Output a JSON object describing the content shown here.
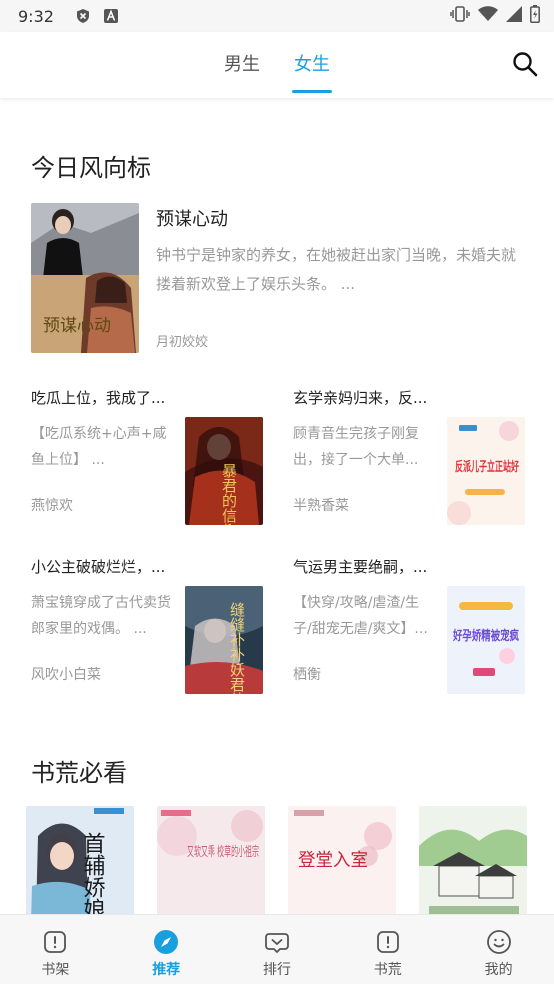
{
  "status": {
    "time": "9:32"
  },
  "tabs": [
    {
      "label": "男生",
      "active": false
    },
    {
      "label": "女生",
      "active": true
    }
  ],
  "accent_color": "#1a9fde",
  "today": {
    "title": "今日风向标",
    "featured": {
      "title": "预谋心动",
      "desc": "钟书宁是钟家的养女，在她被赶出家门当晚，未婚夫就搂着新欢登上了娱乐头条。 ...",
      "author": "月初姣姣",
      "cover_text": "预谋心动"
    },
    "books": [
      {
        "title": "吃瓜上位，我成了...",
        "desc": "【吃瓜系统+心声+咸鱼上位】 ...",
        "author": "燕惊欢",
        "cover_text": "暴君的信仰"
      },
      {
        "title": "玄学亲妈归来，反...",
        "desc": "顾青音生完孩子刚复出，接了一个大单...",
        "author": "半熟香菜",
        "cover_text": "反派儿子立正站好"
      },
      {
        "title": "小公主破破烂烂，...",
        "desc": "萧宝镜穿成了古代卖货郎家里的戏偶。 ...",
        "author": "风吹小白菜",
        "cover_text": "缝缝补补妖君他"
      },
      {
        "title": "气运男主要绝嗣，...",
        "desc": "【快穿/攻略/虐渣/生子/甜宠无虐/爽文】...",
        "author": "栖衡",
        "cover_text": "好孕娇精被宠疯"
      }
    ]
  },
  "must_read": {
    "title": "书荒必看",
    "covers": [
      "首辅娇娘",
      "又软又乖 校草的小祖宗",
      "登堂入室",
      ""
    ]
  },
  "bottom_nav": [
    {
      "label": "书架",
      "icon": "bookshelf-icon",
      "active": false
    },
    {
      "label": "推荐",
      "icon": "compass-icon",
      "active": true
    },
    {
      "label": "排行",
      "icon": "ranking-icon",
      "active": false
    },
    {
      "label": "书荒",
      "icon": "book-shortage-icon",
      "active": false
    },
    {
      "label": "我的",
      "icon": "profile-icon",
      "active": false
    }
  ]
}
